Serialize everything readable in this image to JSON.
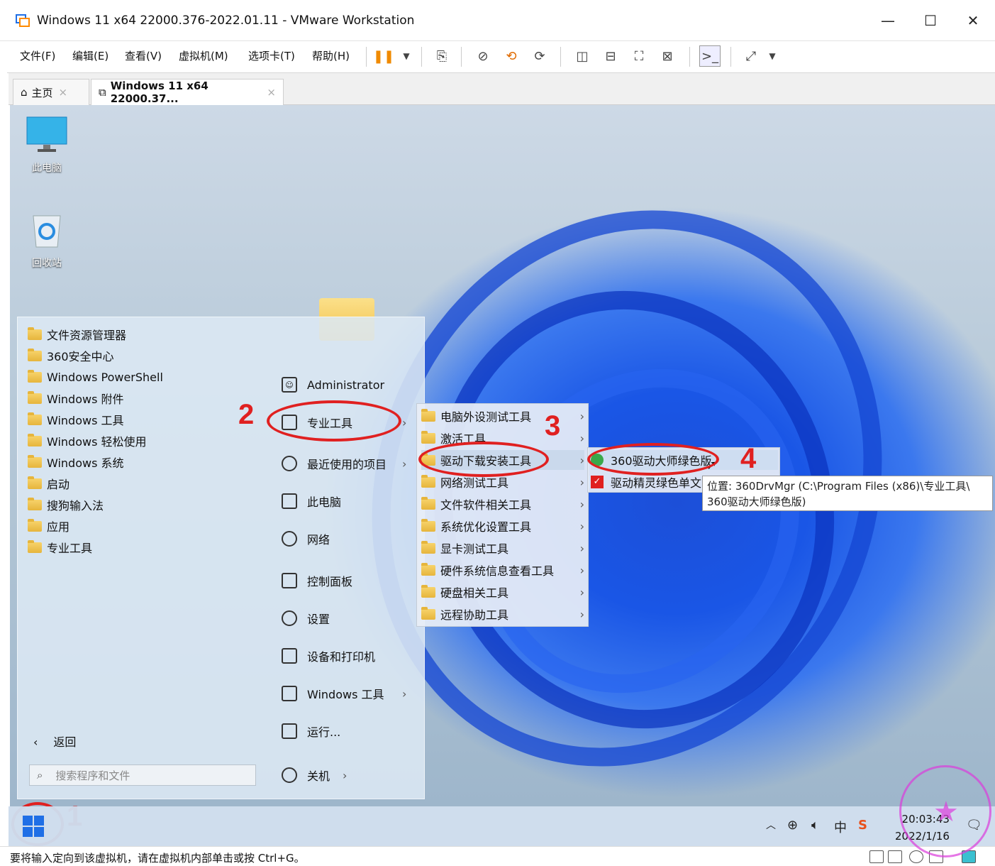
{
  "window": {
    "title": "Windows 11 x64 22000.376-2022.01.11 - VMware Workstation",
    "controls": {
      "minimize": "—",
      "maximize": "☐",
      "close": "✕"
    }
  },
  "menubar": {
    "items": [
      "文件(F)",
      "编辑(E)",
      "查看(V)",
      "虚拟机(M)",
      "选项卡(T)",
      "帮助(H)"
    ]
  },
  "tabs": [
    {
      "label": "主页",
      "close": "×"
    },
    {
      "label": "Windows 11 x64 22000.37...",
      "close": "×"
    }
  ],
  "desktop_icons": [
    {
      "label": "此电脑",
      "icon": "monitor-icon"
    },
    {
      "label": "回收站",
      "icon": "recycle-bin-icon"
    }
  ],
  "start_menu": {
    "programs": [
      "文件资源管理器",
      "360安全中心",
      "Windows PowerShell",
      "Windows 附件",
      "Windows 工具",
      "Windows 轻松使用",
      "Windows 系统",
      "启动",
      "搜狗输入法",
      "应用",
      "专业工具"
    ],
    "right_pane": [
      {
        "label": "Administrator",
        "icon": "user-icon",
        "arrow": ""
      },
      {
        "label": "专业工具",
        "icon": "folder-icon",
        "arrow": "›"
      },
      {
        "label": "最近使用的项目",
        "icon": "clock-icon",
        "arrow": "›"
      },
      {
        "label": "此电脑",
        "icon": "computer-icon",
        "arrow": ""
      },
      {
        "label": "网络",
        "icon": "globe-icon",
        "arrow": ""
      },
      {
        "label": "控制面板",
        "icon": "control-panel-icon",
        "arrow": ""
      },
      {
        "label": "设置",
        "icon": "gear-icon",
        "arrow": ""
      },
      {
        "label": "设备和打印机",
        "icon": "printer-icon",
        "arrow": ""
      },
      {
        "label": "Windows 工具",
        "icon": "tools-icon",
        "arrow": "›"
      },
      {
        "label": "运行...",
        "icon": "run-icon",
        "arrow": ""
      },
      {
        "label": "关机",
        "icon": "power-icon",
        "arrow": "›"
      }
    ],
    "back_label": "返回",
    "search_placeholder": "搜索程序和文件"
  },
  "submenu1": {
    "items": [
      "电脑外设测试工具",
      "激活工具",
      "驱动下载安装工具",
      "网络测试工具",
      "文件软件相关工具",
      "系统优化设置工具",
      "显卡测试工具",
      "硬件系统信息查看工具",
      "硬盘相关工具",
      "远程协助工具"
    ]
  },
  "submenu2": {
    "items": [
      "360驱动大师绿色版",
      "驱动精灵绿色单文"
    ]
  },
  "tooltip": {
    "line1": "位置: 360DrvMgr (C:\\Program Files (x86)\\专业工具\\",
    "line2": "360驱动大师绿色版)"
  },
  "annotations": [
    "1",
    "2",
    "3",
    "4"
  ],
  "taskbar": {
    "time": "20:03:43",
    "date": "2022/1/16",
    "ime": "中"
  },
  "statusbar": {
    "message": "要将输入定向到该虚拟机，请在虚拟机内部单击或按 Ctrl+G。"
  },
  "colors": {
    "annotation_red": "#e02020",
    "accent": "#1f6fe6"
  }
}
